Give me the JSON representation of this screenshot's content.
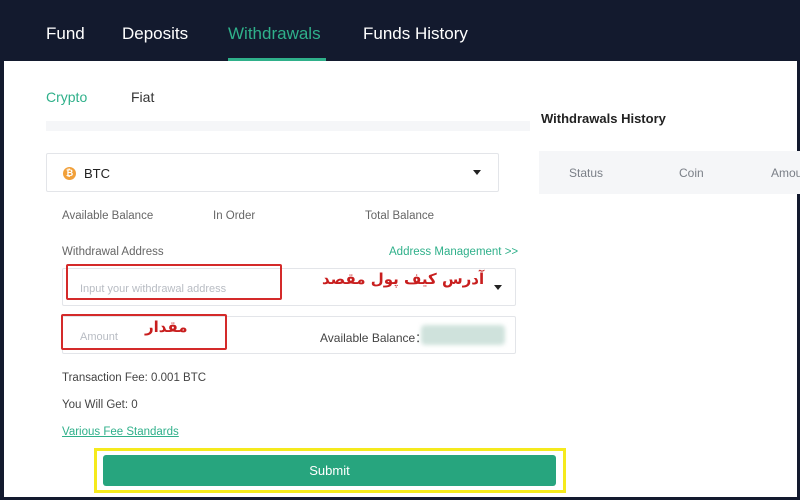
{
  "top_tabs": [
    {
      "label": "Fund"
    },
    {
      "label": "Deposits"
    },
    {
      "label": "Withdrawals"
    },
    {
      "label": "Funds History"
    }
  ],
  "sub_tabs": [
    {
      "label": "Crypto"
    },
    {
      "label": "Fiat"
    }
  ],
  "coin": {
    "symbol": "BTC",
    "icon": "bitcoin-icon"
  },
  "balances": {
    "available": "Available Balance",
    "in_order": "In Order",
    "total": "Total Balance"
  },
  "withdrawal_address": {
    "label": "Withdrawal Address",
    "management_link": "Address Management >>",
    "placeholder": "Input your withdrawal address",
    "annotation": "آدرس کیف پول مقصد"
  },
  "amount": {
    "placeholder": "Amount",
    "annotation": "مقدار",
    "available_label": "Available Balance："
  },
  "fees": {
    "transaction_fee": "Transaction Fee: 0.001  BTC",
    "you_will_get": "You Will Get:  0",
    "fee_standards_link": "Various Fee Standards"
  },
  "submit_label": "Submit",
  "history": {
    "title": "Withdrawals History",
    "columns": [
      "Status",
      "Coin",
      "Amou"
    ]
  },
  "colors": {
    "accent": "#2fb08a",
    "nav_bg": "#131a2e",
    "annotation_red": "#d42a2a",
    "highlight_yellow": "#f5ea1d"
  }
}
